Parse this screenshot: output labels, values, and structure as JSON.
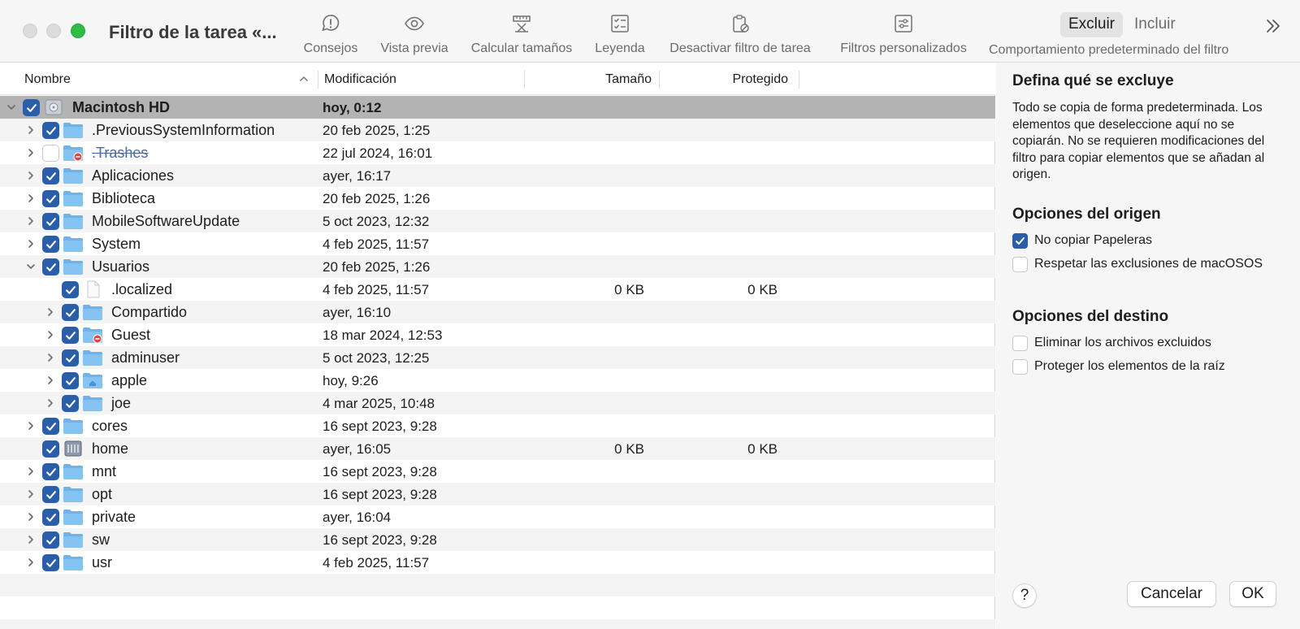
{
  "window": {
    "title": "Filtro de la tarea «..."
  },
  "toolbar": {
    "tools": [
      {
        "label": "Consejos",
        "icon": "tips-bubble-icon"
      },
      {
        "label": "Vista previa",
        "icon": "eye-icon"
      },
      {
        "label": "Calcular tamaños",
        "icon": "ruler-calculate-icon"
      },
      {
        "label": "Leyenda",
        "icon": "checklist-icon"
      },
      {
        "label": "Desactivar filtro de tarea",
        "icon": "clipboard-disable-icon"
      },
      {
        "label": "Filtros personalizados",
        "icon": "sliders-icon"
      }
    ],
    "segment": {
      "options": [
        "Excluir",
        "Incluir"
      ],
      "selected": "Excluir",
      "caption": "Comportamiento predeterminado del filtro"
    }
  },
  "table": {
    "columns": [
      "Nombre",
      "Modificación",
      "Tamaño",
      "Protegido"
    ],
    "rows": [
      {
        "name": "Macintosh HD",
        "date": "hoy, 0:12",
        "size": "",
        "protected": "",
        "level": 0,
        "expanded": true,
        "checked": true,
        "icon": "disk-icon",
        "bold": true,
        "selected": true
      },
      {
        "name": ".PreviousSystemInformation",
        "date": "20 feb 2025, 1:25",
        "size": "",
        "protected": "",
        "level": 1,
        "expandable": true,
        "checked": true,
        "icon": "folder-icon"
      },
      {
        "name": ".Trashes",
        "date": "22 jul 2024, 16:01",
        "size": "",
        "protected": "",
        "level": 1,
        "expandable": true,
        "checked": false,
        "icon": "folder-restricted-icon",
        "strike": true
      },
      {
        "name": "Aplicaciones",
        "date": "ayer, 16:17",
        "size": "",
        "protected": "",
        "level": 1,
        "expandable": true,
        "checked": true,
        "icon": "folder-icon"
      },
      {
        "name": "Biblioteca",
        "date": "20 feb 2025, 1:26",
        "size": "",
        "protected": "",
        "level": 1,
        "expandable": true,
        "checked": true,
        "icon": "folder-icon"
      },
      {
        "name": "MobileSoftwareUpdate",
        "date": "5 oct 2023, 12:32",
        "size": "",
        "protected": "",
        "level": 1,
        "expandable": true,
        "checked": true,
        "icon": "folder-icon"
      },
      {
        "name": "System",
        "date": "4 feb 2025, 11:57",
        "size": "",
        "protected": "",
        "level": 1,
        "expandable": true,
        "checked": true,
        "icon": "folder-icon"
      },
      {
        "name": "Usuarios",
        "date": "20 feb 2025, 1:26",
        "size": "",
        "protected": "",
        "level": 1,
        "expandable": true,
        "expanded": true,
        "checked": true,
        "icon": "folder-icon"
      },
      {
        "name": ".localized",
        "date": "4 feb 2025, 11:57",
        "size": "0 KB",
        "protected": "0 KB",
        "level": 2,
        "expandable": false,
        "checked": true,
        "icon": "file-icon"
      },
      {
        "name": "Compartido",
        "date": "ayer, 16:10",
        "size": "",
        "protected": "",
        "level": 2,
        "expandable": true,
        "checked": true,
        "icon": "folder-icon"
      },
      {
        "name": "Guest",
        "date": "18 mar 2024, 12:53",
        "size": "",
        "protected": "",
        "level": 2,
        "expandable": true,
        "checked": true,
        "icon": "folder-restricted-icon"
      },
      {
        "name": "adminuser",
        "date": "5 oct 2023, 12:25",
        "size": "",
        "protected": "",
        "level": 2,
        "expandable": true,
        "checked": true,
        "icon": "folder-icon"
      },
      {
        "name": "apple",
        "date": "hoy, 9:26",
        "size": "",
        "protected": "",
        "level": 2,
        "expandable": true,
        "checked": true,
        "icon": "home-folder-icon"
      },
      {
        "name": "joe",
        "date": "4 mar 2025, 10:48",
        "size": "",
        "protected": "",
        "level": 2,
        "expandable": true,
        "checked": true,
        "icon": "folder-icon"
      },
      {
        "name": "cores",
        "date": "16 sept 2023, 9:28",
        "size": "",
        "protected": "",
        "level": 1,
        "expandable": true,
        "checked": true,
        "icon": "folder-icon"
      },
      {
        "name": "home",
        "date": "ayer, 16:05",
        "size": "0 KB",
        "protected": "0 KB",
        "level": 1,
        "expandable": false,
        "checked": true,
        "icon": "network-volume-icon"
      },
      {
        "name": "mnt",
        "date": "16 sept 2023, 9:28",
        "size": "",
        "protected": "",
        "level": 1,
        "expandable": true,
        "checked": true,
        "icon": "folder-icon"
      },
      {
        "name": "opt",
        "date": "16 sept 2023, 9:28",
        "size": "",
        "protected": "",
        "level": 1,
        "expandable": true,
        "checked": true,
        "icon": "folder-icon"
      },
      {
        "name": "private",
        "date": "ayer, 16:04",
        "size": "",
        "protected": "",
        "level": 1,
        "expandable": true,
        "checked": true,
        "icon": "folder-icon"
      },
      {
        "name": "sw",
        "date": "16 sept 2023, 9:28",
        "size": "",
        "protected": "",
        "level": 1,
        "expandable": true,
        "checked": true,
        "icon": "folder-icon"
      },
      {
        "name": "usr",
        "date": "4 feb 2025, 11:57",
        "size": "",
        "protected": "",
        "level": 1,
        "expandable": true,
        "checked": true,
        "icon": "folder-icon"
      }
    ]
  },
  "panel": {
    "heading": "Defina qué se excluye",
    "description": "Todo se copia de forma predeterminada. Los elementos que deseleccione aquí no se copiarán. No se requieren modificaciones del filtro para copiar elementos que se añadan al origen.",
    "source_heading": "Opciones del origen",
    "source_options": [
      {
        "label": "No copiar Papeleras",
        "checked": true
      },
      {
        "label": "Respetar las exclusiones de macOSOS",
        "checked": false
      }
    ],
    "dest_heading": "Opciones del destino",
    "dest_options": [
      {
        "label": "Eliminar los archivos excluidos",
        "checked": false
      },
      {
        "label": "Proteger los elementos de la raíz",
        "checked": false
      }
    ],
    "help_label": "?",
    "cancel_label": "Cancelar",
    "ok_label": "OK"
  },
  "colors": {
    "accent": "#2a5ea8",
    "folder": "#6fb3ea",
    "selected_row": "#b3b3b3",
    "zoom_button": "#2fbc45"
  }
}
